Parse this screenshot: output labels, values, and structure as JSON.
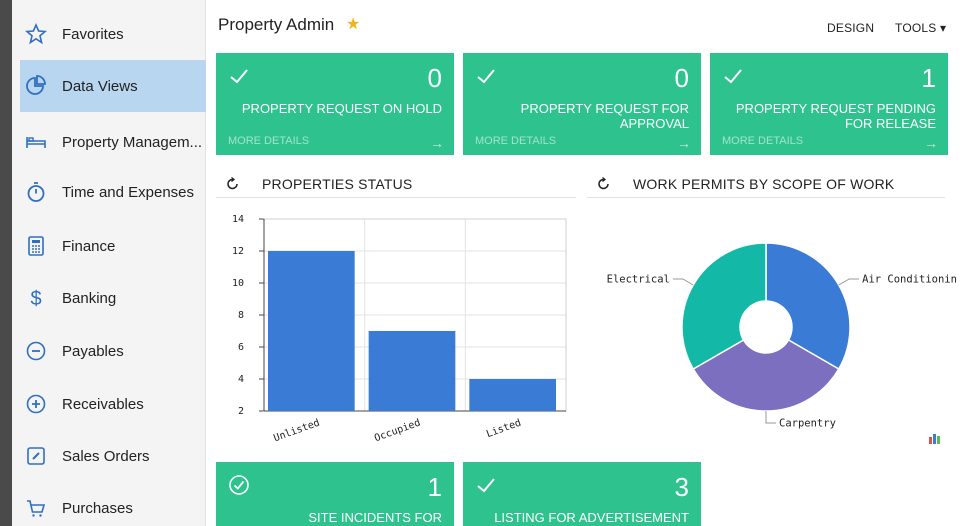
{
  "sidebar": {
    "items": [
      {
        "label": "Favorites",
        "icon": "star-outline-icon",
        "active": false
      },
      {
        "label": "Data Views",
        "icon": "pie-chart-icon",
        "active": true
      },
      {
        "label": "Property Managem...",
        "icon": "bed-icon",
        "active": false
      },
      {
        "label": "Time and Expenses",
        "icon": "stopwatch-icon",
        "active": false
      },
      {
        "label": "Finance",
        "icon": "calculator-icon",
        "active": false
      },
      {
        "label": "Banking",
        "icon": "dollar-icon",
        "active": false
      },
      {
        "label": "Payables",
        "icon": "minus-circle-icon",
        "active": false
      },
      {
        "label": "Receivables",
        "icon": "plus-circle-icon",
        "active": false
      },
      {
        "label": "Sales Orders",
        "icon": "edit-icon",
        "active": false
      },
      {
        "label": "Purchases",
        "icon": "cart-icon",
        "active": false
      }
    ]
  },
  "header": {
    "title": "Property Admin",
    "design_label": "DESIGN",
    "tools_label": "TOOLS ▾"
  },
  "tiles": [
    {
      "count": "0",
      "title": "PROPERTY REQUEST ON HOLD",
      "more": "MORE DETAILS"
    },
    {
      "count": "0",
      "title": "PROPERTY REQUEST FOR\nAPPROVAL",
      "more": "MORE DETAILS"
    },
    {
      "count": "1",
      "title": "PROPERTY REQUEST PENDING\nFOR RELEASE",
      "more": "MORE DETAILS"
    },
    {
      "count": "1",
      "title": "SITE INCIDENTS FOR"
    },
    {
      "count": "3",
      "title": "LISTING FOR ADVERTISEMENT"
    }
  ],
  "colors": {
    "tile_green": "#2ec28e",
    "accent_blue": "#2f6fc4",
    "sidebar_active": "#b8d6ef"
  },
  "properties_status": {
    "title": "PROPERTIES STATUS",
    "chart_data": {
      "type": "bar",
      "categories": [
        "Unlisted",
        "Occupied",
        "Listed"
      ],
      "values": [
        12,
        7,
        4
      ],
      "ylim": [
        2,
        14
      ],
      "yticks": [
        2,
        4,
        6,
        8,
        10,
        12,
        14
      ],
      "color": "#3a7bd5",
      "grid": true
    }
  },
  "work_permits": {
    "title": "WORK PERMITS BY SCOPE OF WORK",
    "chart_data": {
      "type": "pie",
      "donut": true,
      "slices": [
        {
          "label": "Air Conditioning",
          "value": 33.3,
          "color": "#3a7bd5"
        },
        {
          "label": "Carpentry",
          "value": 33.3,
          "color": "#7c6fbf"
        },
        {
          "label": "Electrical",
          "value": 33.3,
          "color": "#13b9a6"
        }
      ]
    }
  }
}
